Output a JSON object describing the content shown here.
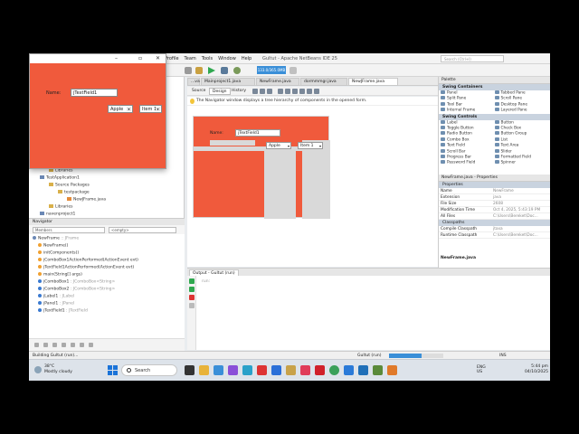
{
  "ide": {
    "window_title": "Gultut - Apache NetBeans IDE 25",
    "search_placeholder": "Search (Ctrl+I)",
    "menu": [
      "Profile",
      "Team",
      "Tools",
      "Window",
      "Help"
    ],
    "memory_label": "133.0/365.0MB",
    "editor_tabs": [
      "...va",
      "Mainproject1.java",
      "NewFrame.java",
      "dormmmgr.java",
      "NewJFrame.java"
    ],
    "design_tabs": [
      "Source",
      "Design",
      "History"
    ],
    "info_message": "The Navigator window displays a tree hierarchy of components in the opened form."
  },
  "projects": {
    "items": [
      {
        "label": "Libraries",
        "level": 2
      },
      {
        "label": "TestApplication1",
        "level": 1
      },
      {
        "label": "Source Packages",
        "level": 2
      },
      {
        "label": "testpackage",
        "level": 3
      },
      {
        "label": "NewJFrame.java",
        "level": 4
      },
      {
        "label": "Libraries",
        "level": 2
      },
      {
        "label": "navenproject1",
        "level": 1
      },
      {
        "label": "Source Packages",
        "level": 2
      }
    ]
  },
  "navigator": {
    "title": "Navigator",
    "combo_left": "Members",
    "combo_right": "<empty>",
    "items": [
      {
        "name": "NewFrame",
        "type": " :: JFrame"
      },
      {
        "name": "NewFrame()",
        "type": ""
      },
      {
        "name": "initComponents()",
        "type": ""
      },
      {
        "name": "jComboBox1ActionPerformed(ActionEvent evt)",
        "type": ""
      },
      {
        "name": "jTextField1ActionPerformed(ActionEvent evt)",
        "type": ""
      },
      {
        "name": "main(String[] args)",
        "type": ""
      },
      {
        "name": "jComboBox1",
        "type": " : JComboBox<String>"
      },
      {
        "name": "jComboBox2",
        "type": " : JComboBox<String>"
      },
      {
        "name": "jLabel1",
        "type": " : JLabel"
      },
      {
        "name": "jPanel1",
        "type": " : JPanel"
      },
      {
        "name": "jTextField1",
        "type": " : JTextField"
      }
    ]
  },
  "design_form": {
    "label": "Name:",
    "textfield": "jTextField1",
    "combo1": "Apple",
    "combo2": "Item 1"
  },
  "palette": {
    "title": "Palette",
    "containers_title": "Swing Containers",
    "containers": [
      "Panel",
      "Tabbed Pane",
      "Split Pane",
      "Scroll Pane",
      "Tool Bar",
      "Desktop Pane",
      "Internal Frame",
      "Layered Pane"
    ],
    "controls_title": "Swing Controls",
    "controls": [
      "Label",
      "Button",
      "Toggle Button",
      "Check Box",
      "Radio Button",
      "Button Group",
      "Combo Box",
      "List",
      "Text Field",
      "Text Area",
      "Scroll Bar",
      "Slider",
      "Progress Bar",
      "Formatted Field",
      "Password Field",
      "Spinner"
    ]
  },
  "properties": {
    "title": "NewFrame.java - Properties",
    "section": "Properties",
    "rows": [
      {
        "k": "Name",
        "v": "NewFrame"
      },
      {
        "k": "Extension",
        "v": "java"
      },
      {
        "k": "File Size",
        "v": "2608"
      },
      {
        "k": "Modification Time",
        "v": "Oct 4, 2025, 5:43:19 PM"
      },
      {
        "k": "All Files",
        "v": "C:\\Users\\Bereket\\Doc..."
      }
    ],
    "section2": "Classpaths",
    "rows2": [
      {
        "k": "Compile Classpath",
        "v": "jtaxa"
      },
      {
        "k": "Runtime Classpath",
        "v": "C:\\Users\\Bereket\\Doc..."
      }
    ],
    "footer": "NewFrame.java"
  },
  "output": {
    "tab": "Output - Gultut (run)",
    "text": "run:"
  },
  "status": {
    "left": "Building Gultut (run)...",
    "task": "Gultut (run)",
    "progress": 0.6,
    "position": "INS"
  },
  "running_app": {
    "label": "Name:",
    "textfield": "jTextField1",
    "combo1": "Apple",
    "combo2": "Item 1"
  },
  "taskbar": {
    "temperature": "38°C",
    "weather": "Mostly cloudy",
    "search": "Search",
    "lang": "ENG",
    "region": "US",
    "time": "5:44 pm",
    "date": "04/10/2025"
  },
  "colors": {
    "form_bg": "#f05a3c",
    "accent": "#3a8fd8"
  }
}
